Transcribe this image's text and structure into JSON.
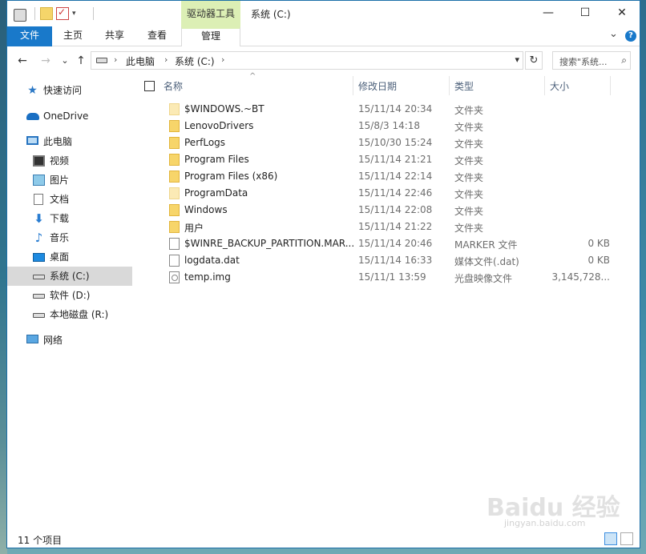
{
  "window": {
    "title": "系统 (C:)",
    "context_tab": "驱动器工具",
    "min_glyph": "—",
    "max_glyph": "☐",
    "close_glyph": "✕"
  },
  "ribbon": {
    "tabs": [
      "文件",
      "主页",
      "共享",
      "查看",
      "管理"
    ],
    "expand_glyph": "⌄",
    "help_glyph": "?"
  },
  "nav": {
    "back_glyph": "←",
    "forward_glyph": "→",
    "recent_glyph": "⌄",
    "up_glyph": "↑",
    "address_parts": [
      "此电脑",
      "系统 (C:)"
    ],
    "address_sep": "›",
    "refresh_glyph": "↻",
    "search_placeholder": "搜索\"系统...",
    "search_glyph": "⌕"
  },
  "sidebar": {
    "items": [
      {
        "label": "快速访问",
        "icon": "star-icon"
      },
      {
        "label": "OneDrive",
        "icon": "cloud-icon"
      },
      {
        "label": "此电脑",
        "icon": "computer-icon"
      },
      {
        "label": "视频",
        "icon": "video-icon"
      },
      {
        "label": "图片",
        "icon": "picture-icon"
      },
      {
        "label": "文档",
        "icon": "document-icon"
      },
      {
        "label": "下载",
        "icon": "download-icon"
      },
      {
        "label": "音乐",
        "icon": "music-icon"
      },
      {
        "label": "桌面",
        "icon": "desktop-icon"
      },
      {
        "label": "系统 (C:)",
        "icon": "drive-icon"
      },
      {
        "label": "软件 (D:)",
        "icon": "drive-icon"
      },
      {
        "label": "本地磁盘 (R:)",
        "icon": "drive-icon"
      },
      {
        "label": "网络",
        "icon": "network-icon"
      }
    ],
    "selected": "系统 (C:)"
  },
  "columns": {
    "name": "名称",
    "modified": "修改日期",
    "type": "类型",
    "size": "大小",
    "sort_glyph": "^"
  },
  "files": [
    {
      "name": "$WINDOWS.~BT",
      "modified": "15/11/14 20:34",
      "type": "文件夹",
      "size": "",
      "icon": "folder-icon"
    },
    {
      "name": "LenovoDrivers",
      "modified": "15/8/3 14:18",
      "type": "文件夹",
      "size": "",
      "icon": "folder-icon"
    },
    {
      "name": "PerfLogs",
      "modified": "15/10/30 15:24",
      "type": "文件夹",
      "size": "",
      "icon": "folder-icon"
    },
    {
      "name": "Program Files",
      "modified": "15/11/14 21:21",
      "type": "文件夹",
      "size": "",
      "icon": "folder-icon"
    },
    {
      "name": "Program Files (x86)",
      "modified": "15/11/14 22:14",
      "type": "文件夹",
      "size": "",
      "icon": "folder-icon"
    },
    {
      "name": "ProgramData",
      "modified": "15/11/14 22:46",
      "type": "文件夹",
      "size": "",
      "icon": "folder-icon"
    },
    {
      "name": "Windows",
      "modified": "15/11/14 22:08",
      "type": "文件夹",
      "size": "",
      "icon": "folder-icon"
    },
    {
      "name": "用户",
      "modified": "15/11/14 21:22",
      "type": "文件夹",
      "size": "",
      "icon": "folder-icon"
    },
    {
      "name": "$WINRE_BACKUP_PARTITION.MAR...",
      "modified": "15/11/14 20:46",
      "type": "MARKER 文件",
      "size": "0 KB",
      "icon": "file-icon"
    },
    {
      "name": "logdata.dat",
      "modified": "15/11/14 16:33",
      "type": "媒体文件(.dat)",
      "size": "0 KB",
      "icon": "file-icon"
    },
    {
      "name": "temp.img",
      "modified": "15/11/1 13:59",
      "type": "光盘映像文件",
      "size": "3,145,728...",
      "icon": "disc-image-icon"
    }
  ],
  "status": {
    "item_count": "11 个项目"
  },
  "watermark": {
    "brand": "Baidu 经验",
    "url": "jingyan.baidu.com"
  },
  "colors": {
    "accent": "#1979ca",
    "context_tab": "#dcefb5",
    "selection": "#d9d9d9"
  }
}
